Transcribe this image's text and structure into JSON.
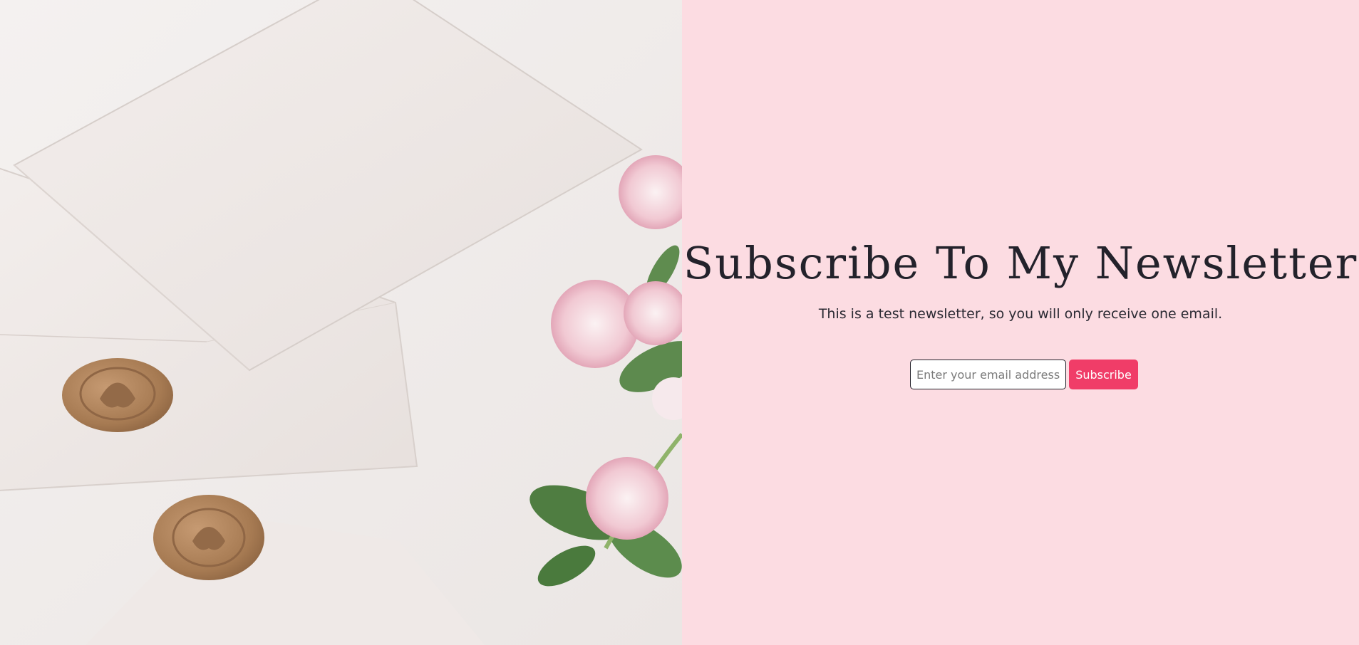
{
  "newsletter": {
    "title": "Subscribe To My Newsletter",
    "subtitle": "This is a test newsletter, so you will only receive one email.",
    "email_placeholder": "Enter your email address",
    "email_value": "",
    "subscribe_label": "Subscribe"
  },
  "colors": {
    "panel_background": "#fcdce2",
    "accent": "#f03d68",
    "text": "#23222b"
  },
  "image": {
    "subject": "envelopes-with-wax-seals-and-flowers"
  }
}
